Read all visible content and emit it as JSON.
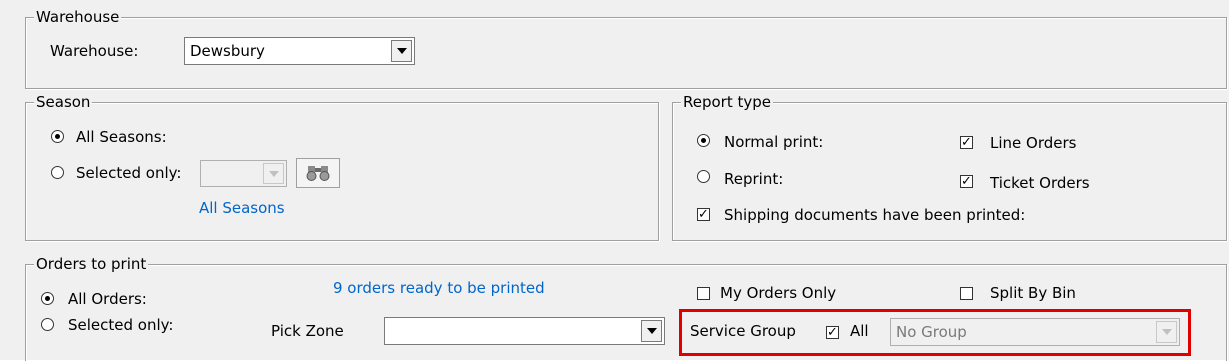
{
  "warehouse": {
    "group_title": "Warehouse",
    "label": "Warehouse:",
    "value": "Dewsbury"
  },
  "season": {
    "group_title": "Season",
    "all_seasons_label": "All Seasons:",
    "selected_only_label": "Selected only:",
    "selected_value": "",
    "link_text": "All Seasons",
    "selected_option": "All Seasons:",
    "binoculars_icon": "binoculars-icon"
  },
  "report_type": {
    "group_title": "Report type",
    "normal_print_label": "Normal print:",
    "reprint_label": "Reprint:",
    "line_orders_label": "Line Orders",
    "ticket_orders_label": "Ticket Orders",
    "shipping_docs_label": "Shipping documents have been printed:",
    "selected_option": "Normal print:",
    "line_orders_checked": true,
    "ticket_orders_checked": true,
    "shipping_docs_checked": true
  },
  "orders": {
    "group_title": "Orders to print",
    "all_orders_label": "All Orders:",
    "selected_only_label": "Selected only:",
    "status_text": "9 orders  ready to be printed",
    "pick_zone_label": "Pick Zone",
    "pick_zone_value": "",
    "my_orders_only_label": "My Orders Only",
    "split_by_bin_label": "Split By Bin",
    "service_group_label": "Service Group",
    "all_label": "All",
    "service_group_value": "No Group",
    "selected_option": "All Orders:",
    "my_orders_only_checked": false,
    "split_by_bin_checked": false,
    "all_checked": true
  },
  "colors": {
    "highlight": "#e00000",
    "link": "#0066cc",
    "background": "#f0f0f0"
  }
}
